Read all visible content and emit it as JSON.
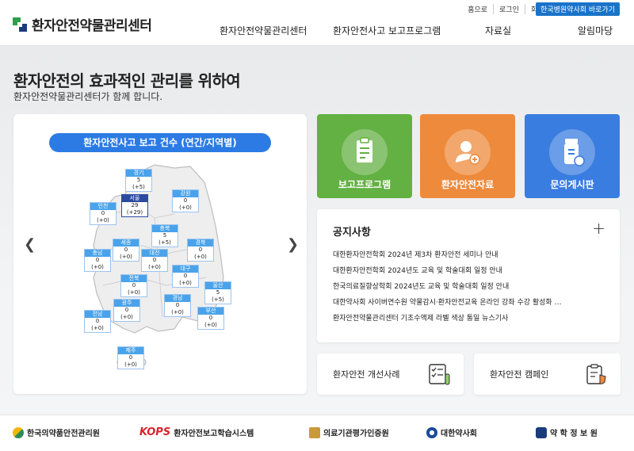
{
  "header": {
    "logo_text": "환자안전약물관리센터",
    "util_links": [
      "홈으로",
      "로그인",
      "회원가입"
    ],
    "util_button": "한국병원약사회 바로가기",
    "nav": [
      "환자안전약물관리센터",
      "환자안전사고 보고프로그램",
      "자료실",
      "알림마당"
    ]
  },
  "hero": {
    "title": "환자안전의 효과적인 관리를 위하여",
    "subtitle": "환자안전약물관리센터가 함께 합니다."
  },
  "map": {
    "title": "환자안전사고 보고 건수 (연간/지역별)",
    "regions": [
      {
        "name": "경기",
        "count": "5",
        "delta": "(+5)"
      },
      {
        "name": "서울",
        "count": "29",
        "delta": "(+29)"
      },
      {
        "name": "강원",
        "count": "0",
        "delta": "(+0)"
      },
      {
        "name": "인천",
        "count": "0",
        "delta": "(+0)"
      },
      {
        "name": "충북",
        "count": "5",
        "delta": "(+5)"
      },
      {
        "name": "세종",
        "count": "0",
        "delta": "(+0)"
      },
      {
        "name": "경북",
        "count": "0",
        "delta": "(+0)"
      },
      {
        "name": "충남",
        "count": "0",
        "delta": "(+0)"
      },
      {
        "name": "대전",
        "count": "0",
        "delta": "(+0)"
      },
      {
        "name": "대구",
        "count": "0",
        "delta": "(+0)"
      },
      {
        "name": "전북",
        "count": "0",
        "delta": "(+0)"
      },
      {
        "name": "울산",
        "count": "5",
        "delta": "(+5)"
      },
      {
        "name": "광주",
        "count": "0",
        "delta": "(+0)"
      },
      {
        "name": "경남",
        "count": "0",
        "delta": "(+0)"
      },
      {
        "name": "전남",
        "count": "0",
        "delta": "(+0)"
      },
      {
        "name": "부산",
        "count": "0",
        "delta": "(+0)"
      },
      {
        "name": "제주",
        "count": "0",
        "delta": "(+0)"
      }
    ]
  },
  "tiles": [
    {
      "label": "보고프로그램",
      "color": "#63b043"
    },
    {
      "label": "환자안전자료",
      "color": "#ee8a3b"
    },
    {
      "label": "문의게시판",
      "color": "#3a7de0"
    }
  ],
  "notice": {
    "title": "공지사항",
    "items": [
      "대한환자안전학회 2024년 제3차 환자안전 세미나 안내",
      "대한환자안전학회 2024년도 교육 및 학술대회 일정 안내",
      "한국의료질향상학회 2024년도 교육 및 학술대회 일정 안내",
      "대한약사회 사이버연수원 약물감시·환자안전교육 온라인 강좌 수강 활성화 …",
      "환자안전약물관리센터 기초수액제 라벨 색상 통일 뉴스기사"
    ]
  },
  "bottom_cards": [
    "환자안전 개선사례",
    "환자안전 캠페인"
  ],
  "partners": [
    "한국의약품안전관리원",
    "환자안전보고학습시스템",
    "의료기관평가인증원",
    "대한약사회",
    "약 학 정 보 원"
  ],
  "partner_logo_text": {
    "kops": "KOPS"
  }
}
